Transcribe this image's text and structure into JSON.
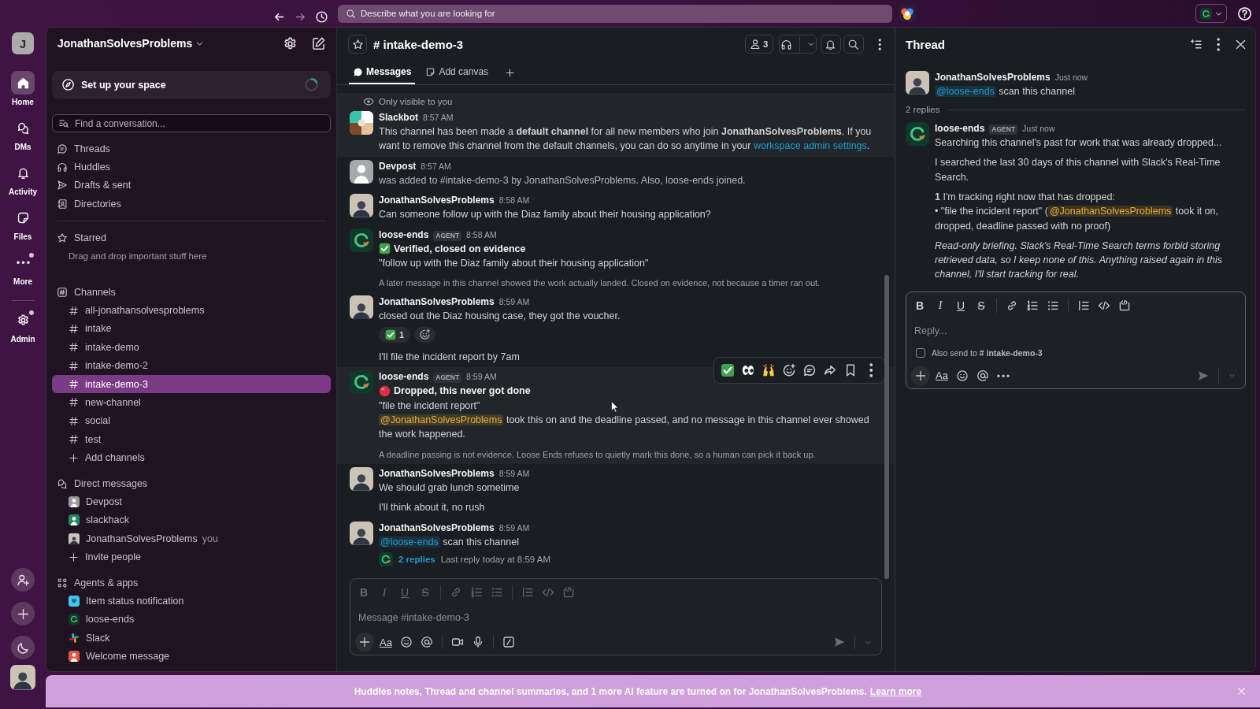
{
  "top_bar": {
    "search_placeholder": "Describe what you are looking for"
  },
  "rail": {
    "workspace_initial": "J",
    "items": [
      {
        "kind": "home",
        "label": "Home",
        "selected": true,
        "dot": false
      },
      {
        "kind": "dms",
        "label": "DMs",
        "selected": false,
        "dot": false
      },
      {
        "kind": "activity",
        "label": "Activity",
        "selected": false,
        "dot": false
      },
      {
        "kind": "files",
        "label": "Files",
        "selected": false,
        "dot": false
      },
      {
        "kind": "more",
        "label": "More",
        "selected": false,
        "dot": true
      },
      {
        "kind": "admin",
        "label": "Admin",
        "selected": false,
        "dot": true
      }
    ]
  },
  "sidebar": {
    "workspace_name": "JonathanSolvesProblems",
    "setup_card": "Set up your space",
    "search_placeholder": "Find a conversation...",
    "nav": [
      {
        "kind": "threads",
        "label": "Threads"
      },
      {
        "kind": "huddles",
        "label": "Huddles"
      },
      {
        "kind": "drafts",
        "label": "Drafts & sent"
      },
      {
        "kind": "directories",
        "label": "Directories"
      }
    ],
    "starred": {
      "title": "Starred",
      "hint": "Drag and drop important stuff here"
    },
    "channels": {
      "title": "Channels",
      "items": [
        {
          "name": "all-jonathansolvesproblems",
          "selected": false
        },
        {
          "name": "intake",
          "selected": false
        },
        {
          "name": "intake-demo",
          "selected": false
        },
        {
          "name": "intake-demo-2",
          "selected": false
        },
        {
          "name": "intake-demo-3",
          "selected": true
        },
        {
          "name": "new-channel",
          "selected": false
        },
        {
          "name": "social",
          "selected": false
        },
        {
          "name": "test",
          "selected": false
        }
      ],
      "add_label": "Add channels"
    },
    "direct_messages": {
      "title": "Direct messages",
      "items": [
        {
          "name": "Devpost",
          "avatar": {
            "kind": "person",
            "color": "#9a9a9c"
          }
        },
        {
          "name": "slackhack",
          "avatar": {
            "kind": "person",
            "color": "#1f8a5b"
          }
        },
        {
          "name": "JonathanSolvesProblems",
          "avatar": {
            "kind": "photo"
          },
          "suffix": "you"
        }
      ],
      "invite_label": "Invite people"
    },
    "apps": {
      "title": "Agents & apps",
      "items": [
        {
          "name": "Item status notification",
          "avatar": {
            "kind": "app",
            "color": "#45c3ea"
          }
        },
        {
          "name": "loose-ends",
          "avatar": {
            "kind": "agent"
          }
        },
        {
          "name": "Slack",
          "avatar": {
            "kind": "logo"
          }
        },
        {
          "name": "Welcome message",
          "avatar": {
            "kind": "person",
            "color": "#e8523c"
          }
        }
      ]
    }
  },
  "channel": {
    "title": "# intake-demo-3",
    "member_count": "3",
    "tabs": [
      {
        "kind": "messages",
        "label": "Messages",
        "selected": true
      },
      {
        "kind": "canvas",
        "label": "Add canvas",
        "selected": false
      }
    ],
    "messages": [
      {
        "kind": "message",
        "hovered": false,
        "note": "Only visible to you",
        "avatar": {
          "kind": "bot"
        },
        "author": "Slackbot",
        "time": "8:57 AM",
        "paragraphs": [
          {
            "kind": "body",
            "parts": [
              {
                "kind": "text",
                "text": "This channel has been made a **default channel** for all new members who join **JonathanSolvesProblems**. If you want to remove this channel from the default channels, you can do so anytime in your "
              },
              {
                "kind": "link",
                "text": "workspace admin settings"
              },
              {
                "kind": "text",
                "text": "."
              }
            ]
          }
        ]
      },
      {
        "kind": "message",
        "hovered": false,
        "avatar": {
          "kind": "person"
        },
        "author": "Devpost",
        "time": "8:57 AM",
        "paragraphs": [
          {
            "kind": "system",
            "parts": [
              {
                "kind": "text",
                "text": "was added to #intake-demo-3 by JonathanSolvesProblems. Also, loose-ends joined."
              }
            ]
          }
        ]
      },
      {
        "kind": "message",
        "hovered": false,
        "avatar": {
          "kind": "photo"
        },
        "author": "JonathanSolvesProblems",
        "time": "8:58 AM",
        "paragraphs": [
          {
            "kind": "body",
            "parts": [
              {
                "kind": "text",
                "text": "Can someone follow up with the Diaz family about their housing application?"
              }
            ]
          }
        ]
      },
      {
        "kind": "message",
        "hovered": false,
        "avatar": {
          "kind": "agent"
        },
        "author": "loose-ends",
        "badge": "AGENT",
        "time": "8:58 AM",
        "paragraphs": [
          {
            "kind": "verified",
            "parts": [
              {
                "kind": "text",
                "text": "Verified, closed on evidence"
              }
            ]
          },
          {
            "kind": "body",
            "parts": [
              {
                "kind": "text",
                "text": "\"follow up with the Diaz family about their housing application\""
              }
            ]
          },
          {
            "kind": "context",
            "parts": [
              {
                "kind": "text",
                "text": "A later message in this channel showed the work actually landed. Closed on evidence, not because a timer ran out."
              }
            ]
          }
        ]
      },
      {
        "kind": "message",
        "hovered": false,
        "avatar": {
          "kind": "photo"
        },
        "author": "JonathanSolvesProblems",
        "time": "8:59 AM",
        "paragraphs": [
          {
            "kind": "body",
            "parts": [
              {
                "kind": "text",
                "text": "closed out the Diaz housing case, they got the voucher."
              }
            ]
          }
        ],
        "reactions": [
          {
            "count": "1",
            "selected": false
          }
        ]
      },
      {
        "kind": "continuation",
        "hovered": false,
        "paragraphs": [
          {
            "kind": "body",
            "parts": [
              {
                "kind": "text",
                "text": "I'll file the incident report by 7am"
              }
            ]
          }
        ]
      },
      {
        "kind": "message",
        "hovered": true,
        "avatar": {
          "kind": "agent"
        },
        "author": "loose-ends",
        "badge": "AGENT",
        "time": "8:59 AM",
        "paragraphs": [
          {
            "kind": "dropped",
            "parts": [
              {
                "kind": "text",
                "text": "Dropped, this never got done"
              }
            ]
          },
          {
            "kind": "body",
            "parts": [
              {
                "kind": "text",
                "text": "\"file the incident report\""
              }
            ]
          },
          {
            "kind": "body",
            "parts": [
              {
                "kind": "mention_self",
                "text": "@JonathanSolvesProblems"
              },
              {
                "kind": "text",
                "text": " took this on and the deadline passed, and no message in this channel ever showed the work happened."
              }
            ]
          },
          {
            "kind": "context",
            "parts": [
              {
                "kind": "text",
                "text": "A deadline passing is not evidence. Loose Ends refuses to quietly mark this done, so a human can pick it back up."
              }
            ]
          }
        ]
      },
      {
        "kind": "message",
        "hovered": false,
        "avatar": {
          "kind": "photo"
        },
        "author": "JonathanSolvesProblems",
        "time": "8:59 AM",
        "paragraphs": [
          {
            "kind": "body",
            "parts": [
              {
                "kind": "text",
                "text": "We should grab lunch sometime"
              }
            ]
          }
        ]
      },
      {
        "kind": "continuation",
        "hovered": false,
        "paragraphs": [
          {
            "kind": "body",
            "parts": [
              {
                "kind": "text",
                "text": "I'll think about it, no rush"
              }
            ]
          }
        ]
      },
      {
        "kind": "message",
        "hovered": false,
        "avatar": {
          "kind": "photo"
        },
        "author": "JonathanSolvesProblems",
        "time": "8:59 AM",
        "paragraphs": [
          {
            "kind": "body",
            "parts": [
              {
                "kind": "mention",
                "text": "@loose-ends"
              },
              {
                "kind": "text",
                "text": " scan this channel"
              }
            ]
          }
        ],
        "thread_summary": {
          "count": "2 replies",
          "last_reply": "Last reply today at 8:59 AM"
        }
      }
    ],
    "composer": {
      "placeholder": "Message #intake-demo-3",
      "formatting_active": false,
      "format_glyphs": [
        {
          "kind": "bold",
          "glyph": "B"
        },
        {
          "kind": "italic",
          "glyph": "I"
        },
        {
          "kind": "underline",
          "glyph": "U"
        },
        {
          "kind": "strike",
          "glyph": "S"
        }
      ],
      "text_format": "Aa"
    }
  },
  "thread": {
    "title": "Thread",
    "parent": {
      "avatar": {
        "kind": "photo"
      },
      "author": "JonathanSolvesProblems",
      "time": "Just now",
      "paragraphs": [
        {
          "kind": "body",
          "parts": [
            {
              "kind": "mention",
              "text": "@loose-ends"
            },
            {
              "kind": "text",
              "text": " scan this channel"
            }
          ]
        }
      ]
    },
    "reply_count": "2 replies",
    "replies": [
      {
        "avatar": {
          "kind": "agent"
        },
        "author": "loose-ends",
        "badge": "AGENT",
        "time": "Just now",
        "paragraphs": [
          {
            "kind": "body",
            "parts": [
              {
                "kind": "text",
                "text": "Searching this channel's past for work that was already dropped..."
              }
            ]
          },
          {
            "kind": "body",
            "parts": [
              {
                "kind": "text",
                "text": "I searched the last 30 days of this channel with Slack's Real-Time Search."
              }
            ]
          },
          {
            "kind": "body",
            "parts": [
              {
                "kind": "text",
                "text": "**1** I'm tracking right now that has dropped:"
              },
              {
                "kind": "break"
              },
              {
                "kind": "text",
                "text": "• \"file the incident report\" ("
              },
              {
                "kind": "mention_self",
                "text": "@JonathanSolvesProblems"
              },
              {
                "kind": "text",
                "text": " took it on, dropped, deadline passed with no proof)"
              }
            ]
          },
          {
            "kind": "italic",
            "parts": [
              {
                "kind": "text",
                "text": "Read-only briefing. Slack's Real-Time Search terms forbid storing retrieved data, so I keep none of this. Anything raised again in this channel, I'll start tracking for real."
              }
            ]
          }
        ]
      }
    ],
    "composer": {
      "placeholder": "Reply...",
      "formatting_active": true,
      "format_glyphs": [
        {
          "kind": "bold",
          "glyph": "B"
        },
        {
          "kind": "italic",
          "glyph": "I"
        },
        {
          "kind": "underline",
          "glyph": "U"
        },
        {
          "kind": "strike",
          "glyph": "S"
        }
      ],
      "text_format": "Aa",
      "also_send": {
        "label": "Also send to **# intake-demo-3**",
        "checked": false
      }
    }
  },
  "banner": {
    "text": "Huddles notes, Thread and channel summaries, and 1 more AI feature are turned on for JonathanSolvesProblems.",
    "link": "Learn more"
  }
}
